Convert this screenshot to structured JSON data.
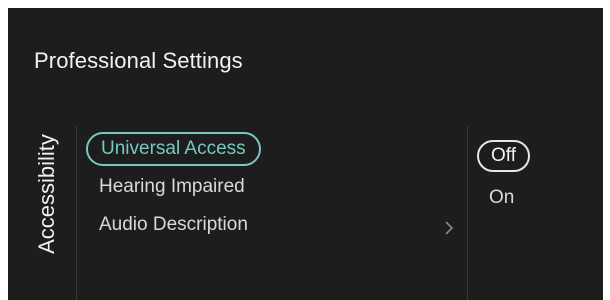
{
  "header": {
    "title": "Professional Settings"
  },
  "category": {
    "label": "Accessibility"
  },
  "menu": {
    "items": [
      {
        "label": "Universal Access",
        "selected": true
      },
      {
        "label": "Hearing Impaired",
        "selected": false
      },
      {
        "label": "Audio Description",
        "selected": false,
        "has_submenu": true
      }
    ]
  },
  "options": {
    "items": [
      {
        "label": "Off",
        "current": true
      },
      {
        "label": "On",
        "current": false
      }
    ]
  },
  "icons": {
    "submenu_indicator": "chevron-right-icon"
  },
  "colors": {
    "background": "#1d1d1d",
    "accent": "#78c8c0",
    "text": "#d9d9d9",
    "divider": "#3a3a3a"
  }
}
